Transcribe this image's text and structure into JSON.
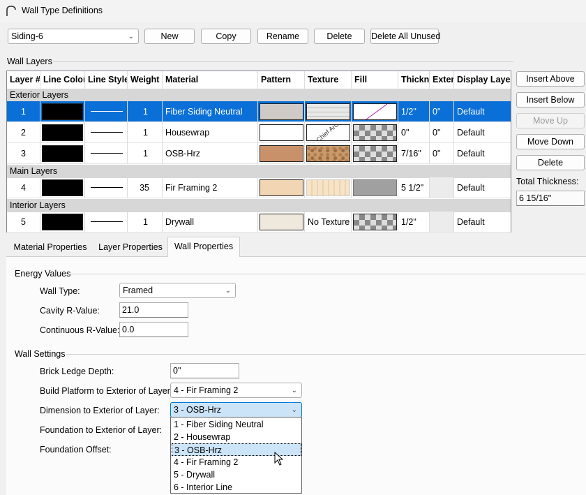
{
  "window": {
    "title": "Wall Type Definitions"
  },
  "toolbar": {
    "wall_type_selected": "Siding-6",
    "new_label": "New",
    "copy_label": "Copy",
    "rename_label": "Rename",
    "delete_label": "Delete",
    "delete_all_unused_label": "Delete All Unused"
  },
  "layers_group": {
    "title": "Wall Layers"
  },
  "table": {
    "columns": [
      "Layer #",
      "Line Color",
      "Line Style",
      "Weight",
      "Material",
      "Pattern",
      "Texture",
      "Fill",
      "Thickn",
      "Exter",
      "Display Layer"
    ],
    "sections": [
      "Exterior Layers",
      "Main Layers",
      "Interior Layers"
    ],
    "rows": [
      {
        "num": "1",
        "weight": "1",
        "material": "Fiber Siding Neutral",
        "texture_text": "",
        "thickness": "1/2\"",
        "exterior": "0\"",
        "display": "Default"
      },
      {
        "num": "2",
        "weight": "1",
        "material": "Housewrap",
        "texture_text": "",
        "thickness": "0\"",
        "exterior": "0\"",
        "display": "Default"
      },
      {
        "num": "3",
        "weight": "1",
        "material": "OSB-Hrz",
        "texture_text": "",
        "thickness": "7/16\"",
        "exterior": "0\"",
        "display": "Default"
      },
      {
        "num": "4",
        "weight": "35",
        "material": "Fir Framing 2",
        "texture_text": "",
        "thickness": "5 1/2\"",
        "exterior": "",
        "display": "Default"
      },
      {
        "num": "5",
        "weight": "1",
        "material": "Drywall",
        "texture_text": "No Texture",
        "thickness": "1/2\"",
        "exterior": "",
        "display": "Default"
      }
    ],
    "texture_watermark": "Chief Arch"
  },
  "side_buttons": {
    "insert_above": "Insert Above",
    "insert_below": "Insert Below",
    "move_up": "Move Up",
    "move_down": "Move Down",
    "delete": "Delete",
    "total_thickness_label": "Total Thickness:",
    "total_thickness_value": "6 15/16\""
  },
  "tabs": [
    "Material Properties",
    "Layer Properties",
    "Wall Properties"
  ],
  "energy": {
    "title": "Energy Values",
    "wall_type_label": "Wall Type:",
    "wall_type_value": "Framed",
    "cavity_label": "Cavity R-Value:",
    "cavity_value": "21.0",
    "continuous_label": "Continuous R-Value:",
    "continuous_value": "0.0"
  },
  "wall_settings": {
    "title": "Wall Settings",
    "brick_ledge_label": "Brick Ledge Depth:",
    "brick_ledge_value": "0\"",
    "build_platform_label": "Build Platform to Exterior of Layer:",
    "build_platform_value": "4 - Fir Framing 2",
    "dimension_label": "Dimension to Exterior of Layer:",
    "dimension_value": "3 - OSB-Hrz",
    "foundation_label": "Foundation to Exterior of Layer:",
    "foundation_offset_label": "Foundation Offset:"
  },
  "dropdown_options": [
    "1 - Fiber Siding Neutral",
    "2 - Housewrap",
    "3 - OSB-Hrz",
    "4 - Fir Framing 2",
    "5 - Drywall",
    "6 - Interior Line"
  ],
  "colors": {
    "selection": "#0a6fd6",
    "accent": "#0078d7"
  }
}
